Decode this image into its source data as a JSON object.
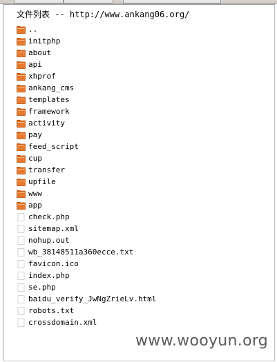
{
  "header": {
    "title": "文件列表 -- http://www.ankang06.org/"
  },
  "icons": {
    "folder": "folder-icon",
    "file": "file-icon"
  },
  "colors": {
    "folder_orange": "#e77a2e",
    "folder_dark": "#b55312",
    "file_border": "#c8c8c8"
  },
  "entries": [
    {
      "name": "..",
      "type": "folder"
    },
    {
      "name": "initphp",
      "type": "folder"
    },
    {
      "name": "about",
      "type": "folder"
    },
    {
      "name": "api",
      "type": "folder"
    },
    {
      "name": "xhprof",
      "type": "folder"
    },
    {
      "name": "ankang_cms",
      "type": "folder"
    },
    {
      "name": "templates",
      "type": "folder"
    },
    {
      "name": "framework",
      "type": "folder"
    },
    {
      "name": "activity",
      "type": "folder"
    },
    {
      "name": "pay",
      "type": "folder"
    },
    {
      "name": "feed_script",
      "type": "folder"
    },
    {
      "name": "cup",
      "type": "folder"
    },
    {
      "name": "transfer",
      "type": "folder"
    },
    {
      "name": "upfile",
      "type": "folder"
    },
    {
      "name": "www",
      "type": "folder"
    },
    {
      "name": "app",
      "type": "folder"
    },
    {
      "name": "check.php",
      "type": "file"
    },
    {
      "name": "sitemap.xml",
      "type": "file"
    },
    {
      "name": "nohup.out",
      "type": "file"
    },
    {
      "name": "wb_38148511a360ecce.txt",
      "type": "file"
    },
    {
      "name": "favicon.ico",
      "type": "file"
    },
    {
      "name": "index.php",
      "type": "file"
    },
    {
      "name": "se.php",
      "type": "file"
    },
    {
      "name": "baidu_verify_JwNgZrieLv.html",
      "type": "file"
    },
    {
      "name": "robots.txt",
      "type": "file"
    },
    {
      "name": "crossdomain.xml",
      "type": "file"
    }
  ],
  "watermark": "www.wooyun.org"
}
